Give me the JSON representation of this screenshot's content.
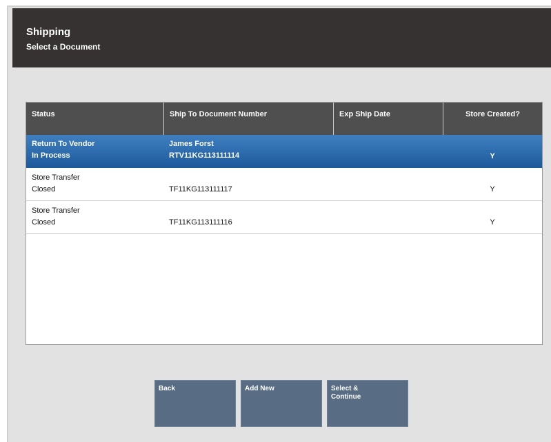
{
  "header": {
    "title": "Shipping",
    "subtitle": "Select a Document"
  },
  "table": {
    "columns": [
      {
        "line1": "Status",
        "line2": ""
      },
      {
        "line1": "Ship To",
        "line2": "Document Number"
      },
      {
        "line1": "Exp Ship",
        "line2": "Date"
      },
      {
        "line1": "Store",
        "line2": "Created?"
      }
    ],
    "rows": [
      {
        "status": "Return To Vendor",
        "state": "In Process",
        "ship_to": "James Forst",
        "doc_number": "RTV11KG113111114",
        "exp_date": "",
        "store_created": "Y"
      },
      {
        "status": "Store Transfer",
        "state": "Closed",
        "ship_to": "",
        "doc_number": "TF11KG113111117",
        "exp_date": "",
        "store_created": "Y"
      },
      {
        "status": "Store Transfer",
        "state": "Closed",
        "ship_to": "",
        "doc_number": "TF11KG113111116",
        "exp_date": "",
        "store_created": "Y"
      }
    ]
  },
  "buttons": {
    "back": "Back",
    "add_new": "Add New",
    "select_continue": "Select &\nContinue"
  }
}
